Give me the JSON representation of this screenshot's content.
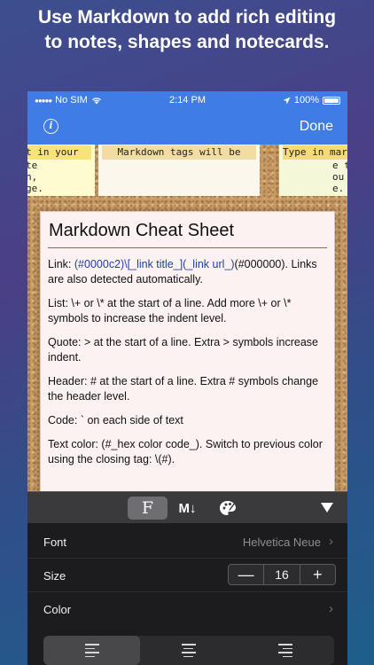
{
  "headline": {
    "line1": "Use Markdown to  add rich editing",
    "line2": "to notes, shapes and notecards."
  },
  "status_bar": {
    "carrier": "No SIM",
    "time": "2:14 PM",
    "battery": "100%"
  },
  "nav": {
    "info_icon": "info-icon",
    "done_label": "Done"
  },
  "cards": {
    "left": {
      "header": "t in your",
      "lines": [
        "te",
        "n,",
        "ge."
      ]
    },
    "middle": {
      "header": "Markdown tags will be"
    },
    "right": {
      "header": "Type in mark",
      "lines": [
        "e t",
        "ou",
        "e."
      ]
    }
  },
  "cheat_sheet": {
    "title": "Markdown Cheat Sheet",
    "link_prefix": "Link:  ",
    "link_code": "(#0000c2)\\[_link title_](_link url_)",
    "link_suffix": "(#000000). Links are also detected automatically.",
    "list": "List:  \\+ or \\* at the start of a line. Add more \\+ or \\* symbols to increase the indent level.",
    "quote": "Quote:  > at the start of a line. Extra > symbols increase indent.",
    "header": "Header:  # at the start of a line. Extra # symbols change the header level.",
    "code": "Code:  ` on each side of text",
    "text_color": "Text color: (#_hex color code_). Switch to previous color using the closing tag: \\(#)."
  },
  "toolbar": {
    "format_label": "F",
    "markdown_label": "M↓",
    "palette_icon": "palette-icon",
    "collapse_icon": "triangle-down-icon"
  },
  "settings": {
    "font_label": "Font",
    "font_value": "Helvetica Neue",
    "size_label": "Size",
    "size_value": "16",
    "minus": "—",
    "plus": "+",
    "color_label": "Color",
    "chevron": "›"
  },
  "colors": {
    "accent": "#3f7ce6",
    "link_blue": "#0000c2",
    "divider_red": "#d64545"
  }
}
